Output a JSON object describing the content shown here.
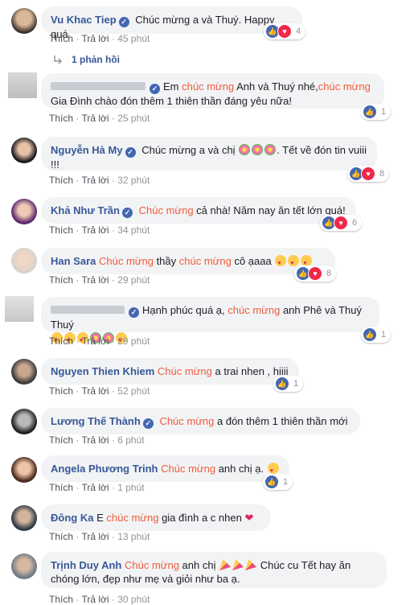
{
  "colors": {
    "name": "#385898",
    "highlight": "#f05c3c",
    "bubble": "#f2f3f5",
    "meta": "#90949c"
  },
  "labels": {
    "like": "Thích",
    "reply": "Trả lời",
    "dot": "·"
  },
  "reply_summary": "1 phản hồi",
  "comments": [
    {
      "name": "Vu Khac Tiep",
      "pre": "Chúc mừng a và Thuý. Happy quá",
      "time": "45 phút",
      "reactions": "4"
    },
    {
      "name": "",
      "t1": "Em ",
      "h1": "chúc mừng",
      "t2": " Anh và Thuý nhé,",
      "h2": "chúc mừng",
      "t3": "Gia Đình chào đón thêm 1 thiên thần đáng yêu nữa!",
      "time": "25 phút",
      "reactions": "1"
    },
    {
      "name": "Nguyễn Hà My",
      "t1": "Chúc mừng a và chị ",
      "t2": ". Tết về đón tin vuiii",
      "t3": "!!!",
      "time": "32 phút",
      "reactions": "8"
    },
    {
      "name": "Khả Như Trần",
      "h1": "Chúc mừng",
      "t1": " cả nhà! Năm nay ăn tết lớn quá!",
      "time": "34 phút",
      "reactions": "6"
    },
    {
      "name": "Han Sara",
      "h1": "Chúc mừng",
      "t1": " thầy ",
      "h2": "chúc mừng",
      "t2": " cô ạaaa",
      "time": "29 phút",
      "reactions": "8"
    },
    {
      "name": "",
      "t1": "Hạnh phúc quá ạ, ",
      "h1": "chúc mừng",
      "t2": " anh Phê và Thuý Thuý",
      "time": "29 phút",
      "reactions": "1"
    },
    {
      "name": "Nguyen Thien Khiem",
      "h1": "Chúc mừng",
      "t1": " a trai nhen , hiiii",
      "time": "52 phút",
      "reactions": "1"
    },
    {
      "name": "Lương Thế Thành",
      "h1": "Chúc mừng",
      "t1": " a đón thêm 1 thiên thần mới",
      "time": "6 phút",
      "reactions": ""
    },
    {
      "name": "Angela Phương Trinh",
      "h1": "Chúc mừng",
      "t1": " anh chị ạ. ",
      "time": "1 phút",
      "reactions": "1"
    },
    {
      "name": "Đông Ka",
      "t0": "E ",
      "h1": "chúc mừng",
      "t1": " gia đình a c nhen ",
      "time": "13 phút",
      "reactions": ""
    },
    {
      "name": "Trịnh Duy Anh",
      "h1": "Chúc mừng",
      "t1": " anh chị ",
      "t2": " Chúc cu Tết hay ăn",
      "t3": "chóng lớn, đẹp như mẹ và giỏi như ba ạ.",
      "time": "30 phút",
      "reactions": ""
    }
  ]
}
